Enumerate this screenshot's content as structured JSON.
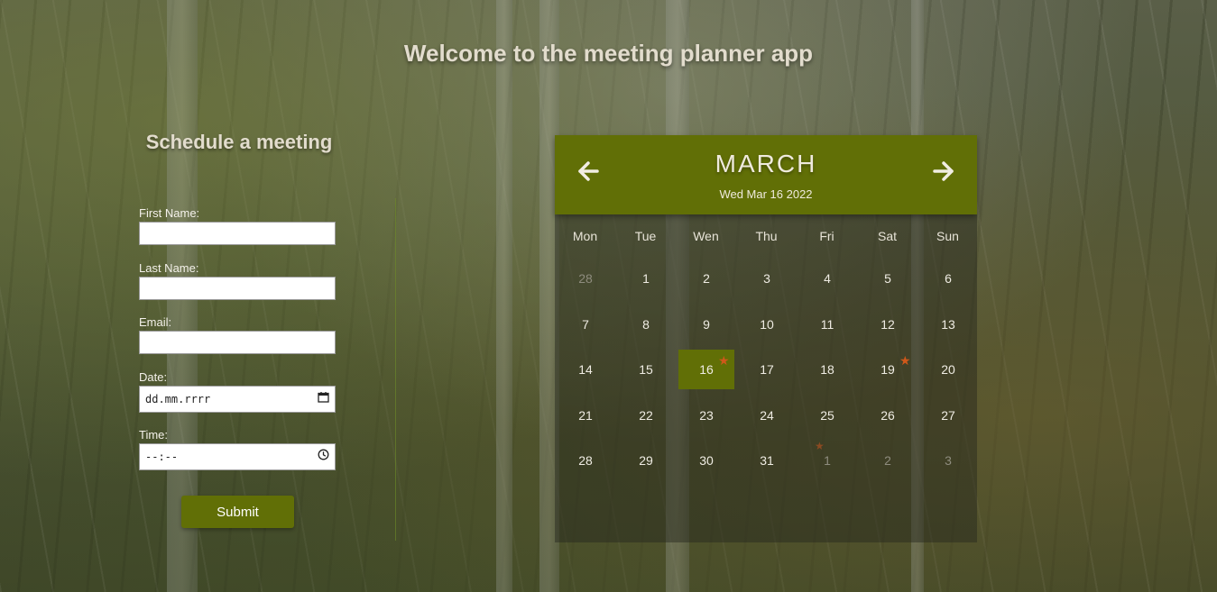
{
  "page": {
    "title": "Welcome to the meeting planner app"
  },
  "form": {
    "title": "Schedule a meeting",
    "first_name_label": "First Name:",
    "first_name_value": "",
    "last_name_label": "Last Name:",
    "last_name_value": "",
    "email_label": "Email:",
    "email_value": "",
    "date_label": "Date:",
    "date_placeholder": "dd.mm.rrrr",
    "time_label": "Time:",
    "time_placeholder": "--:--",
    "submit_label": "Submit"
  },
  "calendar": {
    "month": "MARCH",
    "current_date": "Wed Mar 16 2022",
    "prev_icon": "arrow-left-icon",
    "next_icon": "arrow-right-icon",
    "weekdays": [
      "Mon",
      "Tue",
      "Wen",
      "Thu",
      "Fri",
      "Sat",
      "Sun"
    ],
    "weeks": [
      [
        {
          "d": "28",
          "muted": true
        },
        {
          "d": "1"
        },
        {
          "d": "2"
        },
        {
          "d": "3"
        },
        {
          "d": "4"
        },
        {
          "d": "5"
        },
        {
          "d": "6"
        }
      ],
      [
        {
          "d": "7"
        },
        {
          "d": "8"
        },
        {
          "d": "9"
        },
        {
          "d": "10"
        },
        {
          "d": "11"
        },
        {
          "d": "12"
        },
        {
          "d": "13"
        }
      ],
      [
        {
          "d": "14"
        },
        {
          "d": "15"
        },
        {
          "d": "16",
          "today": true,
          "event": true
        },
        {
          "d": "17"
        },
        {
          "d": "18"
        },
        {
          "d": "19",
          "event": true
        },
        {
          "d": "20"
        }
      ],
      [
        {
          "d": "21"
        },
        {
          "d": "22"
        },
        {
          "d": "23"
        },
        {
          "d": "24"
        },
        {
          "d": "25"
        },
        {
          "d": "26"
        },
        {
          "d": "27"
        }
      ],
      [
        {
          "d": "28"
        },
        {
          "d": "29"
        },
        {
          "d": "30"
        },
        {
          "d": "31"
        },
        {
          "d": "1",
          "muted": true,
          "event": true
        },
        {
          "d": "2",
          "muted": true
        },
        {
          "d": "3",
          "muted": true
        }
      ]
    ],
    "event_icon": "star-icon",
    "colors": {
      "accent": "#616f06",
      "event_star": "#d0581a"
    }
  }
}
